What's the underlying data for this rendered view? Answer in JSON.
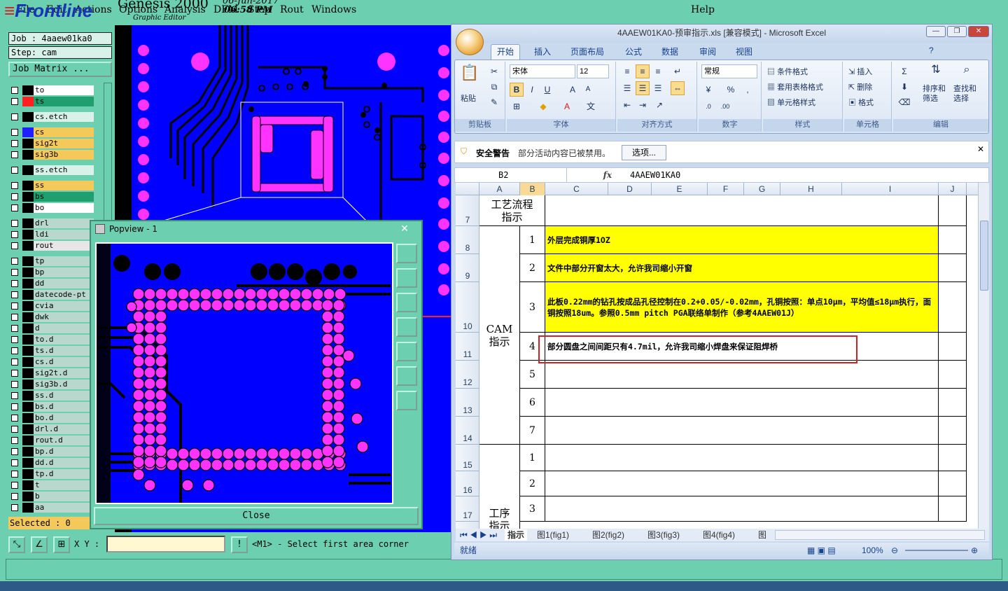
{
  "menu": {
    "items": [
      "File",
      "Edit",
      "Actions",
      "Options",
      "Analysis",
      "DFM",
      "Step",
      "Rout",
      "Windows"
    ],
    "help": "Help"
  },
  "brand": {
    "logo": "Frontline",
    "product": "Genesis 2000",
    "subtitle": "Graphic Editor",
    "date": "06-Jun-2017",
    "time": "06:58 PM"
  },
  "job": {
    "job_label": "Job : 4aaew01ka0",
    "step_label": "Step: cam",
    "matrix_button": "Job Matrix ...",
    "selected": "Selected : 0"
  },
  "layers": [
    {
      "name": "to",
      "bg": "#ffffff",
      "swatch": "#000000"
    },
    {
      "name": "ts",
      "bg": "#1f9e6e",
      "swatch": "#ff2020"
    },
    {
      "name": "cs.etch",
      "bg": "#d8f2ea",
      "swatch": "#000000"
    },
    {
      "name": "cs",
      "bg": "#f5c85a",
      "swatch": "#2020ff"
    },
    {
      "name": "sig2t",
      "bg": "#f5c85a",
      "swatch": "#000000"
    },
    {
      "name": "sig3b",
      "bg": "#f5c85a",
      "swatch": "#000000"
    },
    {
      "name": "ss.etch",
      "bg": "#d8f2ea",
      "swatch": "#000000"
    },
    {
      "name": "ss",
      "bg": "#f5c85a",
      "swatch": "#000000"
    },
    {
      "name": "bs",
      "bg": "#1f9e6e",
      "swatch": "#000000"
    },
    {
      "name": "bo",
      "bg": "#ffffff",
      "swatch": "#000000"
    },
    {
      "name": "drl",
      "bg": "#b8d8ce",
      "swatch": "#000000"
    },
    {
      "name": "ldi",
      "bg": "#b8d8ce",
      "swatch": "#000000"
    },
    {
      "name": "rout",
      "bg": "#e6e6e6",
      "swatch": "#000000"
    },
    {
      "name": "tp",
      "bg": "#b8d8ce",
      "swatch": "#000000"
    },
    {
      "name": "bp",
      "bg": "#b8d8ce",
      "swatch": "#000000"
    },
    {
      "name": "dd",
      "bg": "#b8d8ce",
      "swatch": "#000000"
    },
    {
      "name": "datecode-pt",
      "bg": "#b8d8ce",
      "swatch": "#000000"
    },
    {
      "name": "cvia",
      "bg": "#b8d8ce",
      "swatch": "#000000"
    },
    {
      "name": "dwk",
      "bg": "#b8d8ce",
      "swatch": "#000000"
    },
    {
      "name": "d",
      "bg": "#b8d8ce",
      "swatch": "#000000"
    },
    {
      "name": "to.d",
      "bg": "#b8d8ce",
      "swatch": "#000000"
    },
    {
      "name": "ts.d",
      "bg": "#b8d8ce",
      "swatch": "#000000"
    },
    {
      "name": "cs.d",
      "bg": "#b8d8ce",
      "swatch": "#000000"
    },
    {
      "name": "sig2t.d",
      "bg": "#b8d8ce",
      "swatch": "#000000"
    },
    {
      "name": "sig3b.d",
      "bg": "#b8d8ce",
      "swatch": "#000000"
    },
    {
      "name": "ss.d",
      "bg": "#b8d8ce",
      "swatch": "#000000"
    },
    {
      "name": "bs.d",
      "bg": "#b8d8ce",
      "swatch": "#000000"
    },
    {
      "name": "bo.d",
      "bg": "#b8d8ce",
      "swatch": "#000000"
    },
    {
      "name": "drl.d",
      "bg": "#b8d8ce",
      "swatch": "#000000"
    },
    {
      "name": "rout.d",
      "bg": "#b8d8ce",
      "swatch": "#000000"
    },
    {
      "name": "bp.d",
      "bg": "#b8d8ce",
      "swatch": "#000000"
    },
    {
      "name": "dd.d",
      "bg": "#b8d8ce",
      "swatch": "#000000"
    },
    {
      "name": "tp.d",
      "bg": "#b8d8ce",
      "swatch": "#000000"
    },
    {
      "name": "t",
      "bg": "#b8d8ce",
      "swatch": "#000000"
    },
    {
      "name": "b",
      "bg": "#b8d8ce",
      "swatch": "#000000"
    },
    {
      "name": "aa",
      "bg": "#b8d8ce",
      "swatch": "#000000"
    }
  ],
  "bottom": {
    "xy_label": "X Y :",
    "xy_value": "",
    "bang": "!",
    "prompt": "<M1> - Select first area corner"
  },
  "popview": {
    "title": "Popview - 1",
    "close_x": "✕",
    "close_button": "Close"
  },
  "excel": {
    "title": "4AAEW01KA0-预审指示.xls  [兼容模式] - Microsoft Excel",
    "tabs": [
      "开始",
      "插入",
      "页面布局",
      "公式",
      "数据",
      "审阅",
      "视图"
    ],
    "groups": {
      "clipboard": "剪贴板",
      "font": "字体",
      "alignment": "对齐方式",
      "number": "数字",
      "styles": "样式",
      "cells": "单元格",
      "editing": "编辑"
    },
    "paste": "粘贴",
    "font_name": "宋体",
    "font_size": "12",
    "number_format": "常规",
    "styles_items": [
      "条件格式",
      "套用表格格式",
      "单元格样式"
    ],
    "cells_items": [
      "插入",
      "删除",
      "格式"
    ],
    "sort_label": "排序和\n筛选",
    "find_label": "查找和\n选择",
    "security_title": "安全警告",
    "security_msg": "部分活动内容已被禁用。",
    "security_btn": "选项...",
    "namebox": "B2",
    "fx": "fx",
    "formula": "4AAEW01KA0",
    "columns": [
      "A",
      "B",
      "C",
      "D",
      "E",
      "F",
      "G",
      "H",
      "I",
      "J"
    ],
    "rows": [
      "7",
      "8",
      "9",
      "10",
      "11",
      "12",
      "13",
      "14",
      "15",
      "16",
      "17"
    ],
    "cat_process": "工艺流程\n指示",
    "cat_cam": "CAM\n指示",
    "cat_step": "工序\n指示",
    "cam_items": [
      {
        "n": "1",
        "text": "外层完成铜厚1OZ",
        "yellow": true
      },
      {
        "n": "2",
        "text": "文件中部分开窗太大，允许我司缩小开窗",
        "yellow": true
      },
      {
        "n": "3",
        "text": "此板0.22mm的钻孔按成品孔径控制在0.2+0.05/-0.02mm，孔铜按照：单点10μm，平均值≤18μm执行，面铜按照18um。参照0.5mm pitch PGA联络单制作（参考4AAEW01J）",
        "yellow": true
      },
      {
        "n": "4",
        "text": "部分圆盘之间间距只有4.7mil，允许我司缩小焊盘来保证阻焊桥",
        "yellow": false
      },
      {
        "n": "5",
        "text": "",
        "yellow": false
      },
      {
        "n": "6",
        "text": "",
        "yellow": false
      },
      {
        "n": "7",
        "text": "",
        "yellow": false
      }
    ],
    "step_items": [
      "1",
      "2",
      "3"
    ],
    "sheet_tabs": [
      "指示",
      "图1(fig1)",
      "图2(fig2)",
      "图3(fig3)",
      "图4(fig4)",
      "图"
    ],
    "status": "就绪",
    "zoom": "100%"
  }
}
